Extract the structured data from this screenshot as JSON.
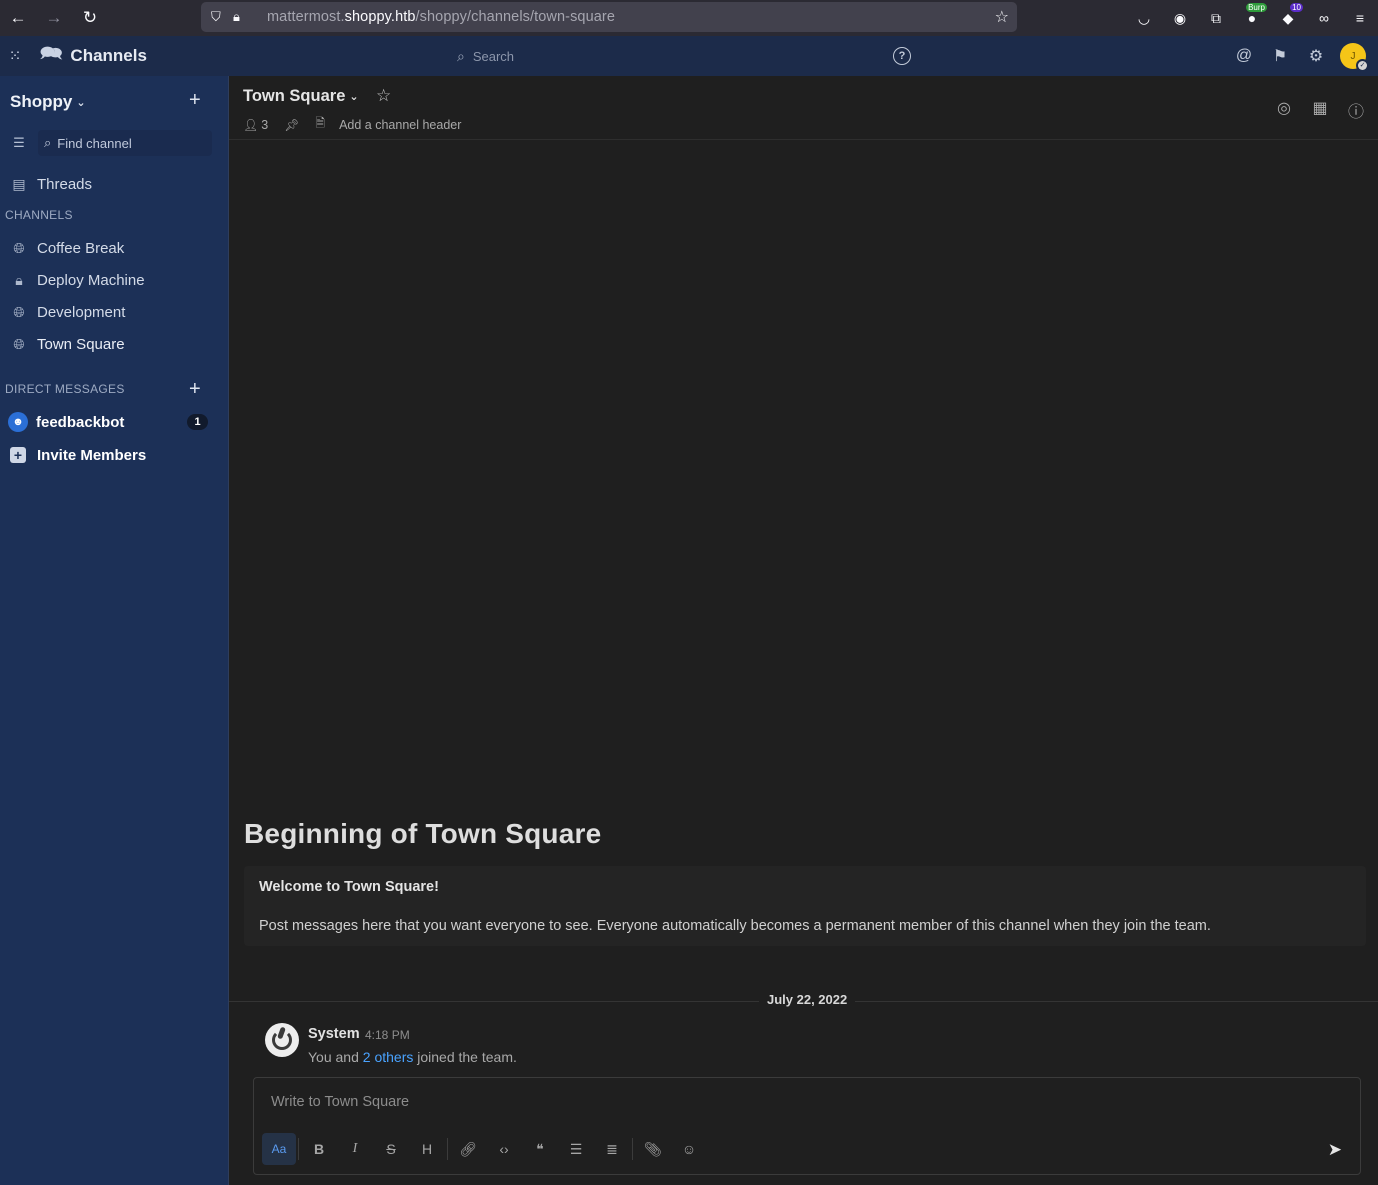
{
  "browser": {
    "url_prefix": "mattermost.",
    "url_host": "shoppy.htb",
    "url_path": "/shoppy/channels/town-square",
    "ext_badge_1": "Burp",
    "ext_badge_2": "10"
  },
  "header": {
    "product": "Channels",
    "search_placeholder": "Search",
    "help": "?",
    "avatar_initial": "J"
  },
  "sidebar": {
    "team": "Shoppy",
    "find_placeholder": "Find channel",
    "threads": "Threads",
    "channels_heading": "CHANNELS",
    "channels": [
      {
        "label": "Coffee Break",
        "icon": "globe-icon"
      },
      {
        "label": "Deploy Machine",
        "icon": "lock-icon"
      },
      {
        "label": "Development",
        "icon": "globe-icon"
      },
      {
        "label": "Town Square",
        "icon": "globe-icon"
      }
    ],
    "dm_heading": "DIRECT MESSAGES",
    "dm": {
      "label": "feedbackbot",
      "unread": "1"
    },
    "invite": "Invite Members"
  },
  "channel": {
    "title": "Town Square",
    "members": "3",
    "header_hint": "Add a channel header"
  },
  "intro": {
    "title": "Beginning of Town Square",
    "welcome": "Welcome to Town Square!",
    "text": "Post messages here that you want everyone to see. Everyone automatically becomes a permanent member of this channel when they join the team."
  },
  "post": {
    "date": "July 22, 2022",
    "author": "System",
    "time": "4:18 PM",
    "text_before": "You and ",
    "link": "2 others",
    "text_after": " joined the team."
  },
  "composer": {
    "placeholder": "Write to Town Square",
    "format_toggle": "Aa"
  },
  "colors": {
    "sidebar": "#1c3057",
    "global_header": "#1c2b4a",
    "center": "#1f1f1f",
    "link": "#4aa3ff"
  }
}
